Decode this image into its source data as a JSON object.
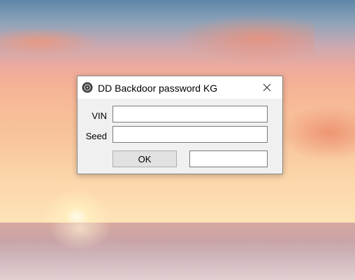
{
  "window": {
    "title": "DD Backdoor password KG",
    "icon": "gear-icon",
    "close_icon": "close-icon"
  },
  "form": {
    "vin_label": "VIN",
    "vin_value": "",
    "seed_label": "Seed",
    "seed_value": "",
    "ok_label": "OK",
    "result_value": ""
  },
  "colors": {
    "dialog_bg": "#f0f0f0",
    "titlebar_bg": "#ffffff",
    "button_bg": "#e1e1e1"
  }
}
